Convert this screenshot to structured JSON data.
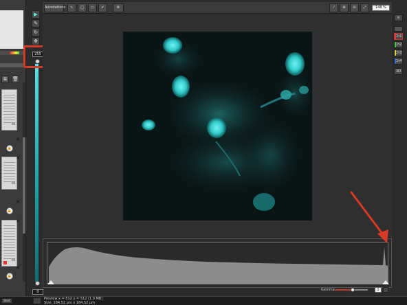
{
  "toolbar": {
    "annotations_label": "Annotations",
    "zoom_level": "148 %"
  },
  "display_range": {
    "max_value": "255",
    "min_value": "0"
  },
  "channels": [
    {
      "label": "Ch1",
      "color": "#e23b3b",
      "selected": true
    },
    {
      "label": "Ch2",
      "color": "#3bd14a",
      "selected": false
    },
    {
      "label": "Ch3",
      "color": "#e2d23b",
      "selected": false
    },
    {
      "label": "Ch4",
      "color": "#3b6be2",
      "selected": false
    }
  ],
  "right_strip": {
    "mode_3d_label": "3D"
  },
  "histogram": {
    "gamma_label": "Gamma",
    "gamma_value": "1",
    "gamma_fraction": 0.5
  },
  "status": {
    "start_label": "Start",
    "line1": "Preview   x = 512  y = 512  (1.0 MB)",
    "line2": "Size: 184.52 µm x 184.52 µm"
  },
  "colors": {
    "channel_color": "#35d3d6",
    "highlight": "#d93a26"
  }
}
